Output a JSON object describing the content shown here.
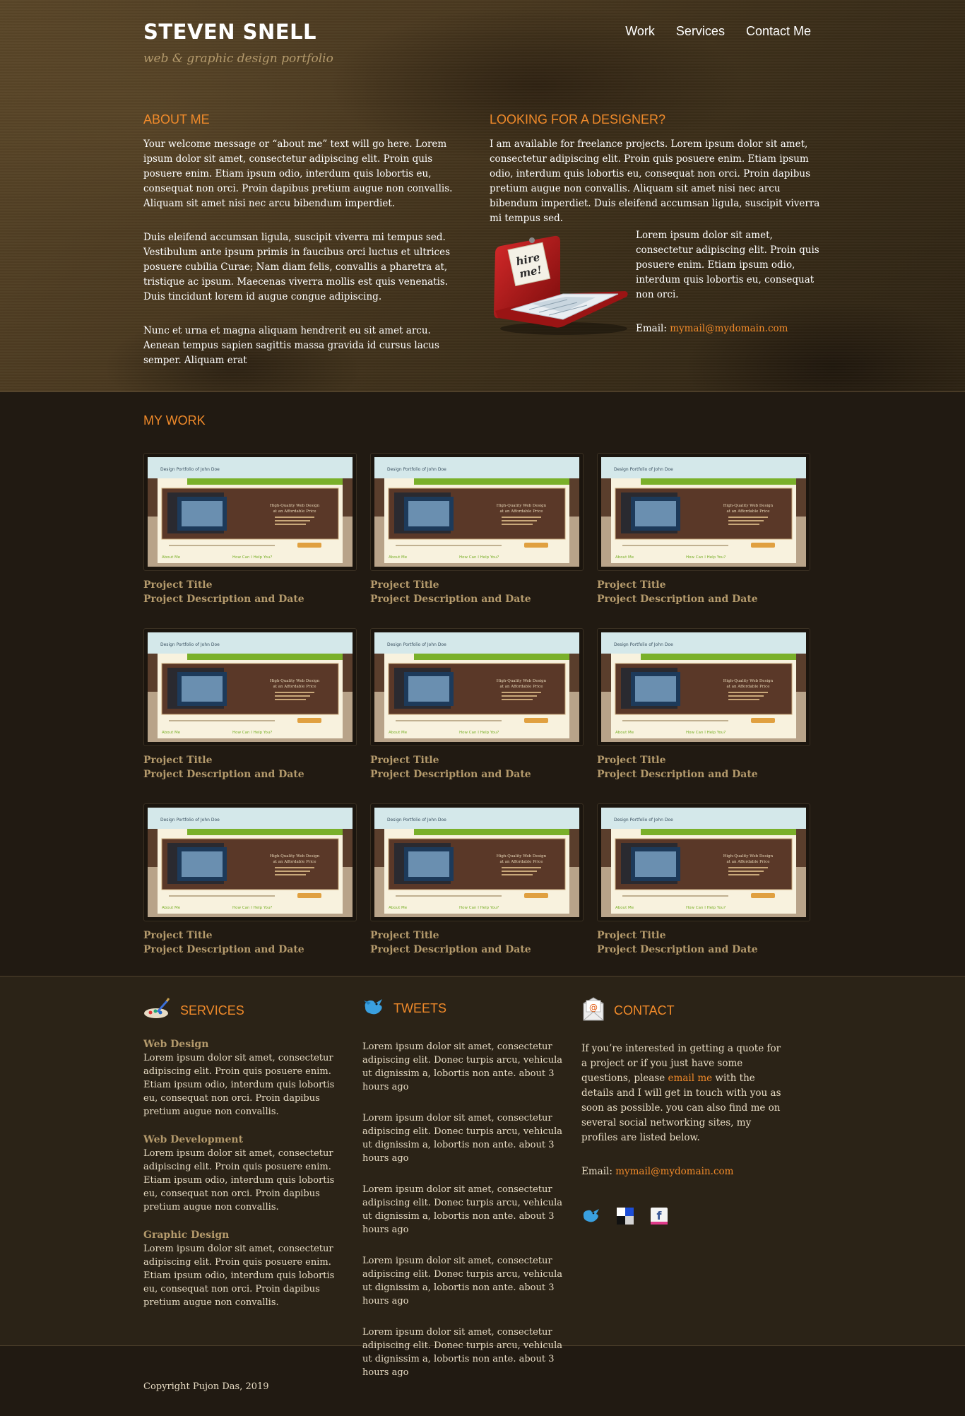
{
  "header": {
    "title": "STEVEN SNELL",
    "tagline": "web & graphic design portfolio",
    "nav": [
      "Work",
      "Services",
      "Contact Me"
    ]
  },
  "about": {
    "heading": "ABOUT ME",
    "paragraphs": [
      "Your welcome message or “about me” text will go here. Lorem ipsum dolor sit amet, consectetur adipiscing elit. Proin quis posuere enim. Etiam ipsum odio, interdum quis lobortis eu, consequat non orci. Proin dapibus pretium augue non convallis. Aliquam sit amet nisi nec arcu bibendum imperdiet.",
      "Duis eleifend accumsan ligula, suscipit viverra mi tempus sed. Vestibulum ante ipsum primis in faucibus orci luctus et ultrices posuere cubilia Curae; Nam diam felis, convallis a pharetra at, tristique ac ipsum. Maecenas viverra mollis est quis venenatis. Duis tincidunt lorem id augue congue adipiscing.",
      "Nunc et urna et magna aliquam hendrerit eu sit amet arcu. Aenean tempus sapien sagittis massa gravida id cursus lacus semper. Aliquam erat"
    ]
  },
  "designer": {
    "heading": "LOOKING FOR A DESIGNER?",
    "intro": "I am available for freelance projects. Lorem ipsum dolor sit amet, consectetur adipiscing elit. Proin quis posuere enim. Etiam ipsum odio, interdum quis lobortis eu, consequat non orci. Proin dapibus pretium augue non convallis. Aliquam sit amet nisi nec arcu bibendum imperdiet. Duis eleifend accumsan ligula, suscipit viverra mi tempus sed.",
    "side_text": "Lorem ipsum dolor sit amet, consectetur adipiscing elit. Proin quis posuere enim. Etiam ipsum odio, interdum quis lobortis eu, consequat non orci.",
    "email_label": "Email: ",
    "email": "mymail@mydomain.com",
    "hire_note": "hire me!"
  },
  "work": {
    "heading": "MY WORK",
    "thumb_header": "Design Portfolio of John Doe",
    "thumb_promo": "High-Quality Web Design at an Affordable Price",
    "thumb_about": "About Me",
    "thumb_help": "How Can I Help You?",
    "projects": [
      {
        "title": "Project Title",
        "desc": "Project Description and Date"
      },
      {
        "title": "Project Title",
        "desc": "Project Description and Date"
      },
      {
        "title": "Project Title",
        "desc": "Project Description and Date"
      },
      {
        "title": "Project Title",
        "desc": "Project Description and Date"
      },
      {
        "title": "Project Title",
        "desc": "Project Description and Date"
      },
      {
        "title": "Project Title",
        "desc": "Project Description and Date"
      },
      {
        "title": "Project Title",
        "desc": "Project Description and Date"
      },
      {
        "title": "Project Title",
        "desc": "Project Description and Date"
      },
      {
        "title": "Project Title",
        "desc": "Project Description and Date"
      }
    ]
  },
  "services": {
    "heading": "SERVICES",
    "items": [
      {
        "title": "Web Design",
        "text": "Lorem ipsum dolor sit amet, consectetur adipiscing elit. Proin quis posuere enim. Etiam ipsum odio, interdum quis lobortis eu, consequat non orci. Proin dapibus pretium augue non convallis."
      },
      {
        "title": "Web Development",
        "text": "Lorem ipsum dolor sit amet, consectetur adipiscing elit. Proin quis posuere enim. Etiam ipsum odio, interdum quis lobortis eu, consequat non orci. Proin dapibus pretium augue non convallis."
      },
      {
        "title": "Graphic Design",
        "text": "Lorem ipsum dolor sit amet, consectetur adipiscing elit. Proin quis posuere enim. Etiam ipsum odio, interdum quis lobortis eu, consequat non orci. Proin dapibus pretium augue non convallis."
      }
    ]
  },
  "tweets": {
    "heading": "TWEETS",
    "items": [
      "Lorem ipsum dolor sit amet, consectetur adipiscing elit. Donec turpis arcu, vehicula ut dignissim a, lobortis non ante. about 3 hours ago",
      "Lorem ipsum dolor sit amet, consectetur adipiscing elit. Donec turpis arcu, vehicula ut dignissim a, lobortis non ante. about 3 hours ago",
      "Lorem ipsum dolor sit amet, consectetur adipiscing elit. Donec turpis arcu, vehicula ut dignissim a, lobortis non ante. about 3 hours ago",
      "Lorem ipsum dolor sit amet, consectetur adipiscing elit. Donec turpis arcu, vehicula ut dignissim a, lobortis non ante. about 3 hours ago",
      "Lorem ipsum dolor sit amet, consectetur adipiscing elit. Donec turpis arcu, vehicula ut dignissim a, lobortis non ante. about 3 hours ago"
    ]
  },
  "contact": {
    "heading": "CONTACT",
    "text_before": "If you’re interested in getting a quote for a project or if you just have some questions, please ",
    "link": "email me",
    "text_after": " with the details and I will get in touch with you as soon as possible. you can also find me on several social networking sites, my profiles are listed below.",
    "email_label": "Email: ",
    "email": "mymail@mydomain.com",
    "social": [
      "twitter-icon",
      "delicious-icon",
      "facebook-icon"
    ]
  },
  "footer": {
    "copyright": "Copyright Pujon Das, 2019"
  },
  "colors": {
    "accent": "#f08a2a",
    "muted": "#b49a6c",
    "background": "#211a12"
  }
}
